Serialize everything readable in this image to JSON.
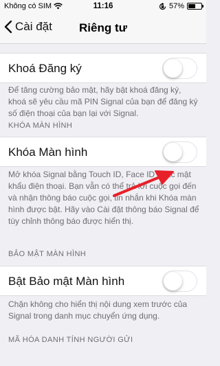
{
  "status_bar": {
    "carrier": "Không có SIM",
    "time": "11:16",
    "battery_percent": "57%",
    "battery_level": 0.57,
    "icons": [
      "wifi-icon",
      "orientation-lock-icon",
      "battery-icon"
    ]
  },
  "nav": {
    "back_label": "Cài đặt",
    "title": "Riêng tư"
  },
  "settings": {
    "registration_lock": {
      "label": "Khoá Đăng ký",
      "enabled": false,
      "note": "Để tăng cường bảo mật, hãy bật khoá đăng ký, khoá sẽ yêu cầu mã PIN Signal của bạn để đăng ký số điện thoại của bạn lại với Signal."
    },
    "screen_lock": {
      "header": "KHÓA MÀN HÌNH",
      "label": "Khóa Màn hình",
      "enabled": false,
      "note": "Mở khóa Signal bằng Touch ID, Face ID hoặc mật khẩu điện thoại. Bạn vẫn có thể trả lời cuộc gọi đến và nhận thông báo cuộc gọi, tin nhắn khi Khóa màn hình được bật. Hãy vào Cài đặt thông báo Signal để tùy chỉnh thông báo được hiển thị."
    },
    "screen_security": {
      "header": "BẢO MẬT MÀN HÌNH",
      "label": "Bật Bảo mật Màn hình",
      "enabled": false,
      "note": "Chặn không cho hiển thị nội dung xem trước của Signal trong danh mục chuyển ứng dụng."
    },
    "sender_identity": {
      "header": "MÃ HÓA DANH TÍNH NGƯỜI GỬI"
    }
  },
  "colors": {
    "background": "#efeff4",
    "note_text": "#6d6d72",
    "annotation_arrow": "#e8202a"
  }
}
